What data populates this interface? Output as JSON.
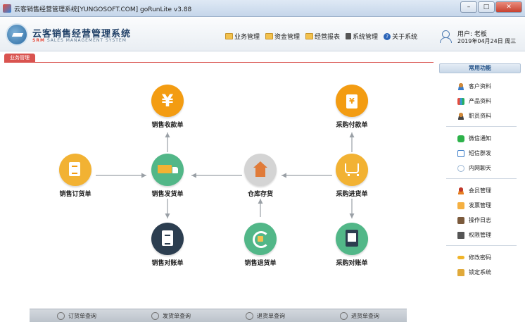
{
  "window": {
    "title": "云客销售经营管理系统[YUNGOSOFT.COM]  goRunLite v3.88",
    "minimize_label": "–",
    "maximize_label": "□",
    "close_label": "✕"
  },
  "brand": {
    "title": "云客销售经营管理系统",
    "subtitle_abbr": "SRM",
    "subtitle": "SALES MANAGEMENT SYSTEM"
  },
  "topnav": [
    {
      "label": "业务管理",
      "icon": "folder-icon"
    },
    {
      "label": "资金管理",
      "icon": "folder-icon"
    },
    {
      "label": "经营报表",
      "icon": "folder-icon"
    },
    {
      "label": "系统管理",
      "icon": "document-icon"
    },
    {
      "label": "关于系统",
      "icon": "help-icon"
    }
  ],
  "user": {
    "name": "用户: 老板",
    "date": "2019年04月24日 周三"
  },
  "tab": {
    "label": "业务管理"
  },
  "diagram": {
    "nodes": {
      "sales_receipt": {
        "label": "销售收款单",
        "color": "#f39c12",
        "icon": "yen-icon"
      },
      "purchase_payment": {
        "label": "采购付款单",
        "color": "#f39c12",
        "icon": "money-document-icon"
      },
      "sales_order": {
        "label": "销售订货单",
        "color": "#f2b233",
        "icon": "order-form-icon"
      },
      "sales_delivery": {
        "label": "销售发货单",
        "color": "#52b788",
        "icon": "truck-icon"
      },
      "warehouse_stock": {
        "label": "仓库存货",
        "color": "#c9c9c9",
        "icon": "house-icon"
      },
      "purchase_receipt": {
        "label": "采购进货单",
        "color": "#f2b233",
        "icon": "cart-icon"
      },
      "sales_statement": {
        "label": "销售对账单",
        "color": "#2c3e50",
        "icon": "clipboard-icon"
      },
      "sales_return": {
        "label": "销售退货单",
        "color": "#52b788",
        "icon": "refresh-icon"
      },
      "purchase_statement": {
        "label": "采购对账单",
        "color": "#52b788",
        "icon": "checklist-icon"
      }
    },
    "arrow_color": "#9aa0a6"
  },
  "sidebar": {
    "header": "常用功能",
    "groups": [
      [
        {
          "label": "客户资料",
          "icon": "customer-icon"
        },
        {
          "label": "产品资料",
          "icon": "product-icon"
        },
        {
          "label": "职员资料",
          "icon": "staff-icon"
        }
      ],
      [
        {
          "label": "微信通知",
          "icon": "wechat-icon"
        },
        {
          "label": "短信群发",
          "icon": "sms-icon"
        },
        {
          "label": "内网聊天",
          "icon": "chat-icon"
        }
      ],
      [
        {
          "label": "会员管理",
          "icon": "member-icon"
        },
        {
          "label": "发票管理",
          "icon": "invoice-icon"
        },
        {
          "label": "操作日志",
          "icon": "log-icon"
        },
        {
          "label": "权限管理",
          "icon": "permission-icon"
        }
      ],
      [
        {
          "label": "修改密码",
          "icon": "key-icon"
        },
        {
          "label": "锁定系统",
          "icon": "lock-icon"
        }
      ]
    ]
  },
  "bottombar": [
    {
      "label": "订货单查询"
    },
    {
      "label": "发货单查询"
    },
    {
      "label": "退货单查询"
    },
    {
      "label": "进货单查询"
    }
  ]
}
